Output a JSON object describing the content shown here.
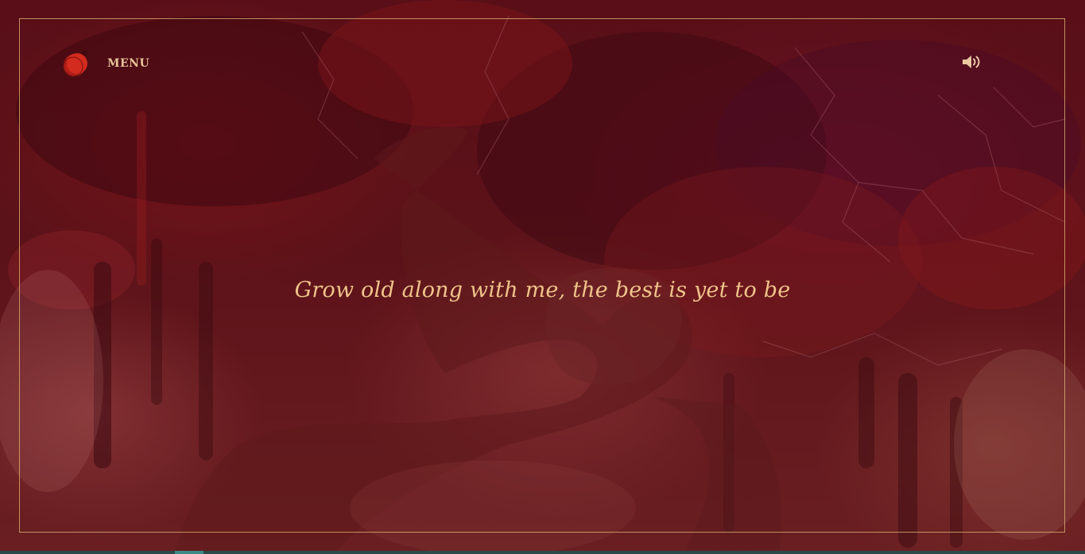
{
  "menu": {
    "label": "MENU",
    "logo_icon": "pomegranate-logo-icon"
  },
  "sound": {
    "icon": "speaker-volume-icon"
  },
  "quote": {
    "text": "Grow old along with me, the best is yet to be"
  },
  "colors": {
    "accent_text": "#efc38a",
    "frame_border": "#e1b978",
    "background": "#5a0f18",
    "logo_red": "#c8251a"
  }
}
